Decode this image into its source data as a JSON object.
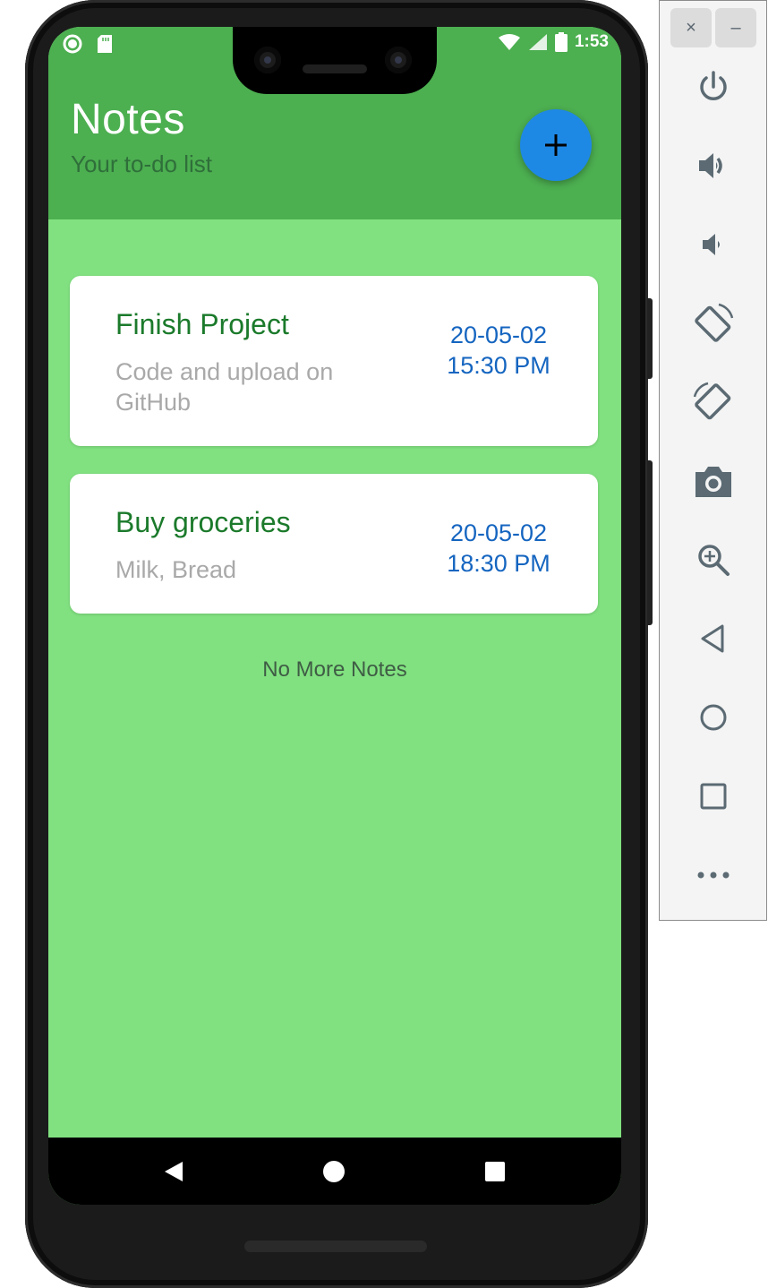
{
  "status_bar": {
    "time": "1:53"
  },
  "header": {
    "title": "Notes",
    "subtitle": "Your to-do list",
    "add_icon": "plus-icon"
  },
  "notes": [
    {
      "title": "Finish Project",
      "description": "Code and upload on GitHub",
      "date": "20-05-02",
      "time": "15:30 PM"
    },
    {
      "title": "Buy groceries",
      "description": "Milk, Bread",
      "date": "20-05-02",
      "time": "18:30 PM"
    }
  ],
  "footer_text": "No More Notes",
  "colors": {
    "header": "#4caf50",
    "background": "#81e180",
    "fab": "#1e88e5",
    "note_title": "#1b7a2b",
    "note_date": "#1565c0"
  },
  "nav": {
    "icons": [
      "back-icon",
      "home-icon",
      "recents-icon"
    ]
  },
  "emulator_toolbar": {
    "close_label": "×",
    "minimize_label": "–",
    "icons": [
      "power-icon",
      "volume-up-icon",
      "volume-down-icon",
      "rotate-left-icon",
      "rotate-right-icon",
      "camera-icon",
      "zoom-icon",
      "back-icon",
      "home-icon",
      "overview-icon",
      "more-icon"
    ]
  }
}
